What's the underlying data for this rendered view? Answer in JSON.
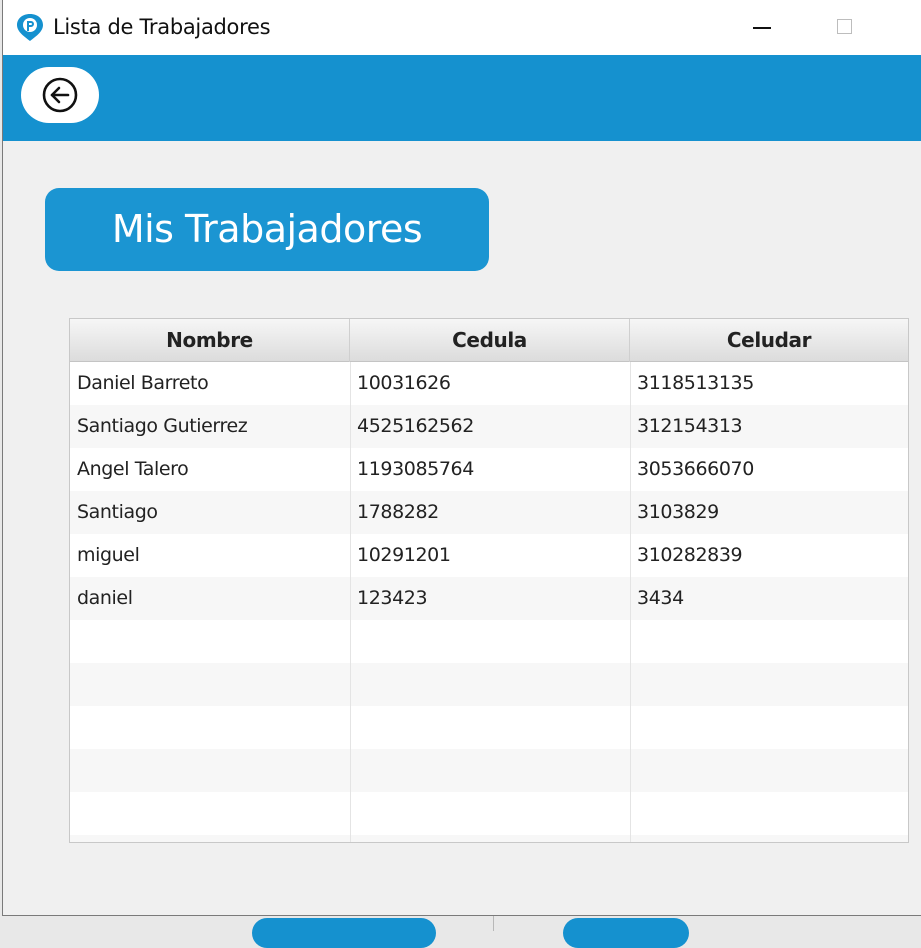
{
  "window": {
    "title": "Lista de Trabajadores"
  },
  "heading": "Mis Trabajadores",
  "icons": {
    "app": "app-pin-icon",
    "back": "arrow-left-circle-icon",
    "minimize": "minimize-icon",
    "maximize": "maximize-icon"
  },
  "colors": {
    "toolbar": "#1591cf",
    "heading_pill": "#1b95d2"
  },
  "table": {
    "columns": [
      "Nombre",
      "Cedula",
      "Celudar"
    ],
    "rows": [
      [
        "Daniel Barreto",
        "10031626",
        "3118513135"
      ],
      [
        "Santiago Gutierrez",
        "4525162562",
        "312154313"
      ],
      [
        "Angel Talero",
        "1193085764",
        "3053666070"
      ],
      [
        "Santiago",
        "1788282",
        "3103829"
      ],
      [
        "miguel",
        "10291201",
        "310282839"
      ],
      [
        "daniel",
        "123423",
        "3434"
      ]
    ],
    "empty_rows": 5
  }
}
